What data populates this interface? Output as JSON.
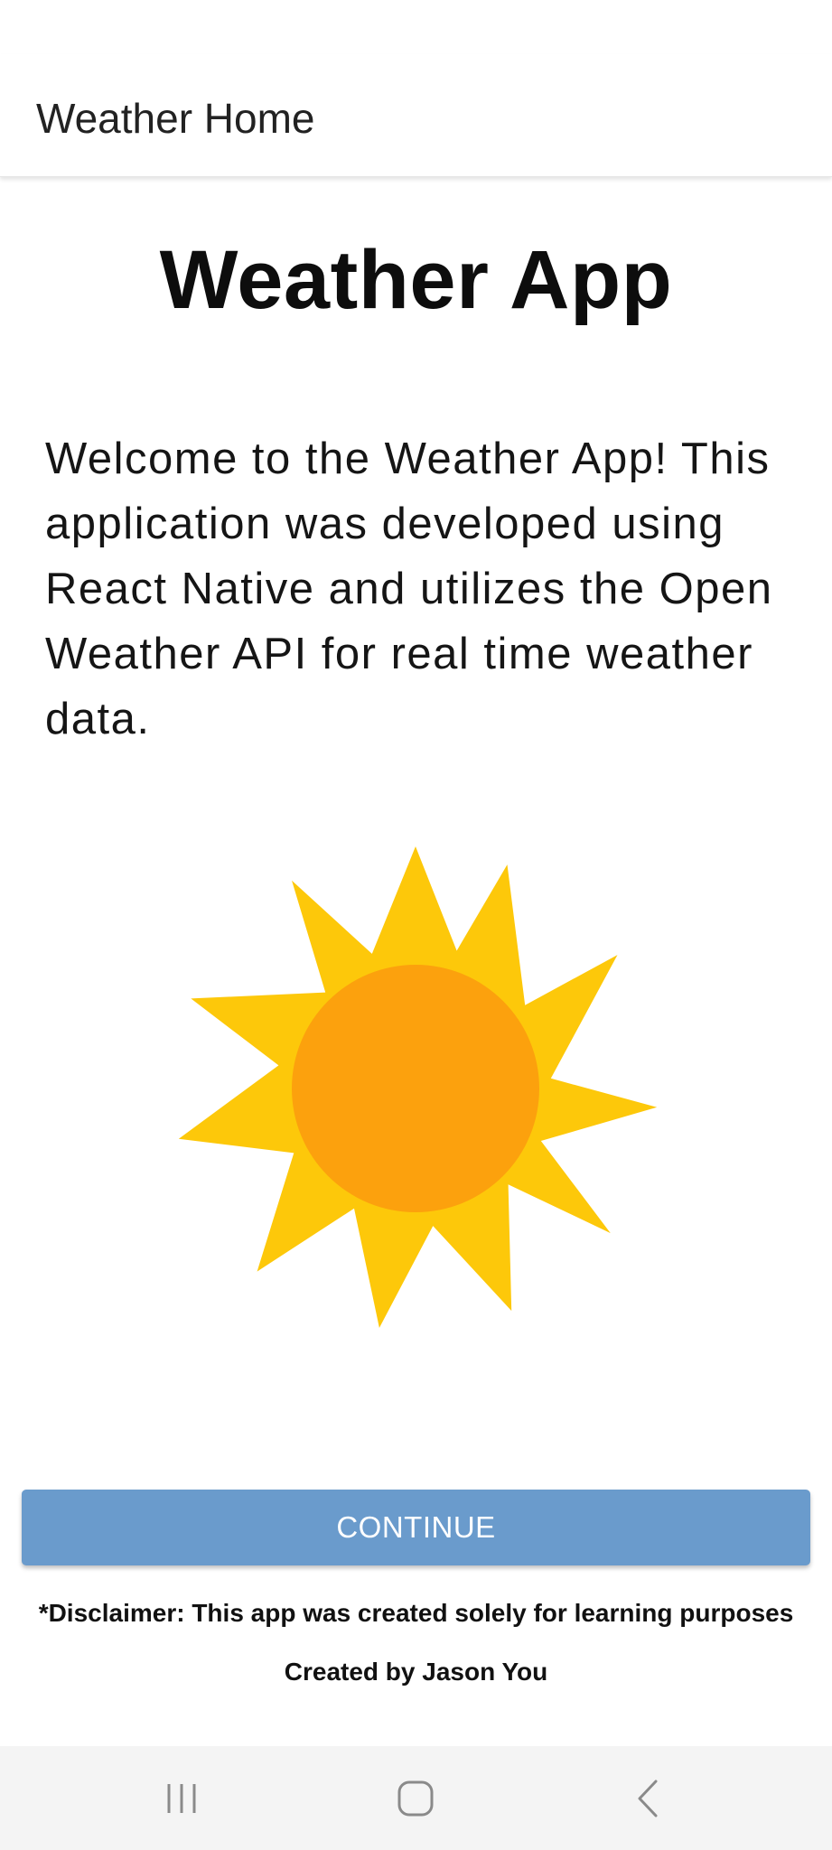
{
  "header": {
    "title": "Weather Home"
  },
  "main": {
    "title": "Weather App",
    "welcome": "Welcome to the Weather App! This application was developed using React Native and utilizes the Open Weather API for real time weather data.",
    "illustration_icon": "sun-icon",
    "continue_label": "CONTINUE",
    "disclaimer": "*Disclaimer: This app was created solely for learning purposes",
    "credit": "Created by Jason You"
  },
  "navbar": {
    "recents_icon": "recents-icon",
    "home_icon": "home-icon",
    "back_icon": "back-icon"
  },
  "colors": {
    "button": "#6a9bcc",
    "sun_rays": "#fdc80a",
    "sun_core": "#fca10d"
  }
}
